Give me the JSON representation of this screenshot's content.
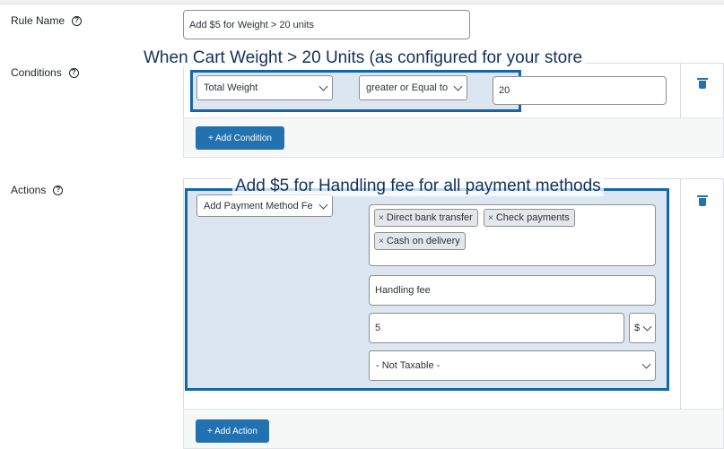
{
  "rule_name": {
    "label": "Rule Name",
    "value": "Add $5 for Weight > 20 units"
  },
  "conditions": {
    "label": "Conditions",
    "field_select": "Total Weight",
    "operator_select": "greater or Equal to",
    "value": "20",
    "add_button": "+ Add Condition"
  },
  "actions": {
    "label": "Actions",
    "action_select": "Add Payment Method Fe",
    "payment_methods": [
      "Direct bank transfer",
      "Check payments",
      "Cash on delivery"
    ],
    "tag_remove_glyph": "×",
    "fee_label": "Handling fee",
    "amount": "5",
    "currency": "$",
    "tax_select": "- Not Taxable -",
    "add_button": "+ Add Action"
  },
  "annotations": {
    "conditions": "When Cart Weight > 20 Units (as configured for your store",
    "actions": "Add $5 for Handling fee for all payment methods"
  },
  "icons": {
    "help": "help-circle-icon",
    "delete": "trash-icon",
    "dropdown": "chevron-down-icon"
  },
  "colors": {
    "accent": "#2271b1",
    "highlight_border": "#1565a8"
  }
}
